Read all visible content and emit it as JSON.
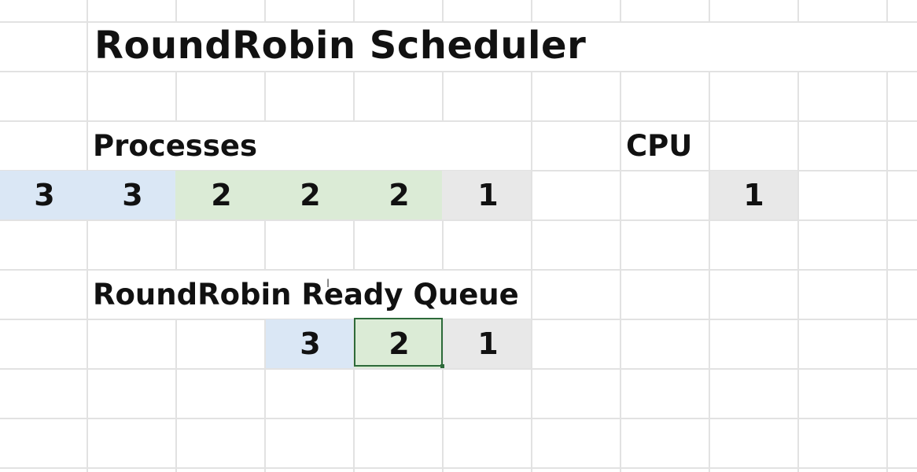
{
  "title": "RoundRobin Scheduler",
  "processes": {
    "label": "Processes",
    "cells": [
      {
        "value": "3",
        "color": "#dae7f5"
      },
      {
        "value": "3",
        "color": "#dae7f5"
      },
      {
        "value": "2",
        "color": "#dbebd6"
      },
      {
        "value": "2",
        "color": "#dbebd6"
      },
      {
        "value": "2",
        "color": "#dbebd6"
      },
      {
        "value": "1",
        "color": "#e8e8e8"
      }
    ]
  },
  "cpu": {
    "label": "CPU",
    "value": "1",
    "color": "#e8e8e8"
  },
  "ready_queue": {
    "label": "RoundRobin Ready Queue",
    "cells": [
      {
        "value": "3",
        "color": "#dae7f5"
      },
      {
        "value": "2",
        "color": "#dbebd6",
        "selected": true
      },
      {
        "value": "1",
        "color": "#e8e8e8"
      }
    ]
  },
  "colors": {
    "grid": "#e2e2e2",
    "selection": "#2d6a3a",
    "text": "#111111"
  }
}
